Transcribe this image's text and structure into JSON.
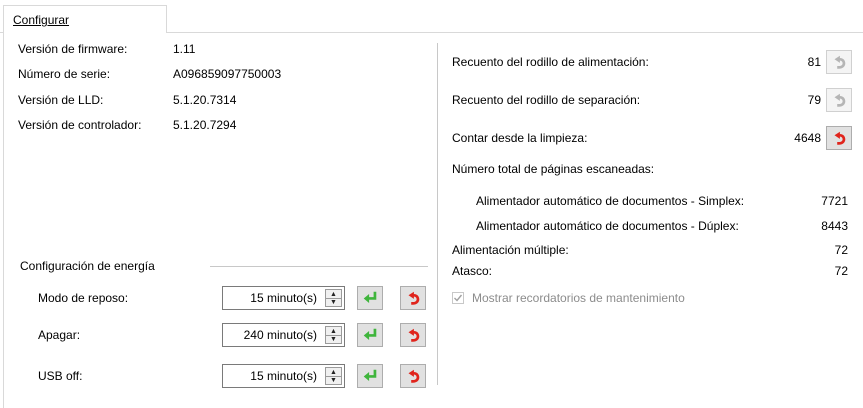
{
  "tab": {
    "label": "Configurar"
  },
  "info": [
    {
      "label": "Versión de firmware:",
      "value": "1.11"
    },
    {
      "label": "Número de serie:",
      "value": "A096859097750003"
    },
    {
      "label": "Versión de LLD:",
      "value": "5.1.20.7314"
    },
    {
      "label": "Versión de controlador:",
      "value": "5.1.20.7294"
    }
  ],
  "power": {
    "title": "Configuración de energía",
    "rows": [
      {
        "label": "Modo de reposo:",
        "value": "15 minuto(s)"
      },
      {
        "label": "Apagar:",
        "value": "240 minuto(s)"
      },
      {
        "label": "USB off:",
        "value": "15 minuto(s)"
      }
    ]
  },
  "counters": {
    "feed_roller_label": "Recuento del rodillo de alimentación:",
    "feed_roller_value": "81",
    "sep_roller_label": "Recuento del rodillo de separación:",
    "sep_roller_value": "79",
    "since_clean_label": "Contar desde la limpieza:",
    "since_clean_value": "4648",
    "total_label": "Número total de páginas escaneadas:",
    "simplex_label": "Alimentador automático de documentos - Simplex:",
    "simplex_value": "7721",
    "duplex_label": "Alimentador automático de documentos - Dúplex:",
    "duplex_value": "8443",
    "multifeed_label": "Alimentación múltiple:",
    "multifeed_value": "72",
    "jam_label": "Atasco:",
    "jam_value": "72"
  },
  "reminders": {
    "label": "Mostrar recordatorios de mantenimiento",
    "checked": true
  },
  "colors": {
    "apply": "#3fb53c",
    "reset": "#e0241c",
    "disabled_icon": "#b5b5b5"
  }
}
